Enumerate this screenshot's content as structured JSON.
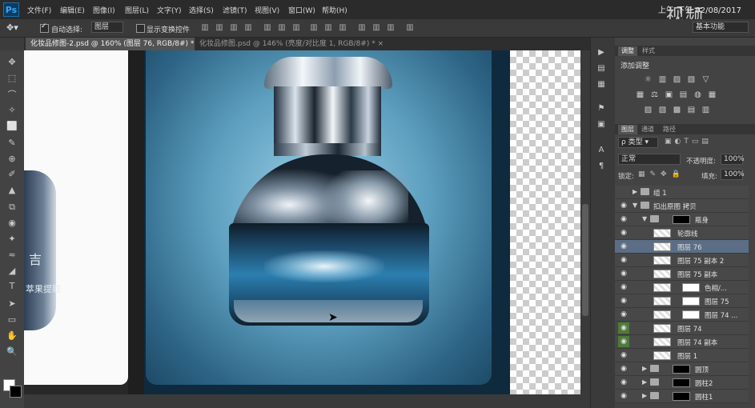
{
  "app": {
    "logo": "Ps",
    "datetime": "上午 下午 02/08/2017",
    "watermark": "视频"
  },
  "menu": [
    "文件(F)",
    "编辑(E)",
    "图像(I)",
    "图层(L)",
    "文字(Y)",
    "选择(S)",
    "滤镜(T)",
    "视图(V)",
    "窗口(W)",
    "帮助(H)"
  ],
  "options": {
    "auto_select_label": "自动选择:",
    "auto_select_value": "图层",
    "show_transform_label": "显示变换控件",
    "workspace": "基本功能"
  },
  "tabs": [
    {
      "label": "化妆品修图-2.psd @ 160% (图层 76, RGB/8#) *"
    },
    {
      "label": "化妆品修图.psd @ 146% (亮度/对比度 1, RGB/8#) *"
    }
  ],
  "canvas_text": {
    "left_text_1": "吉",
    "left_text_2": "萃果提取"
  },
  "panels": {
    "adjust_tab": "调整",
    "style_tab": "样式",
    "add_adjust": "添加调整",
    "layers_tab": "图层",
    "channels_tab": "通道",
    "paths_tab": "路径",
    "filter_kind": "类型",
    "blend_mode": "正常",
    "opacity_label": "不透明度:",
    "opacity_value": "100%",
    "lock_label": "锁定:",
    "fill_label": "填充:",
    "fill_value": "100%"
  },
  "layers": [
    {
      "name": "组 1",
      "kind": "group",
      "visible": false,
      "indent": 0,
      "expanded": false
    },
    {
      "name": "扣出原图 拷贝",
      "kind": "group",
      "visible": true,
      "indent": 0,
      "expanded": true
    },
    {
      "name": "瓶身",
      "kind": "group",
      "visible": true,
      "indent": 1,
      "expanded": true
    },
    {
      "name": "轮廓线",
      "kind": "layer",
      "visible": true,
      "indent": 2
    },
    {
      "name": "图层 76",
      "kind": "layer",
      "visible": true,
      "indent": 2,
      "selected": true
    },
    {
      "name": "图层 75 副本 2",
      "kind": "layer",
      "visible": true,
      "indent": 2
    },
    {
      "name": "图层 75 副本",
      "kind": "layer",
      "visible": true,
      "indent": 2
    },
    {
      "name": "色相/...",
      "kind": "adjust",
      "visible": true,
      "indent": 2
    },
    {
      "name": "图层 75",
      "kind": "layer",
      "visible": true,
      "indent": 2
    },
    {
      "name": "图层 74 ...",
      "kind": "layer",
      "visible": true,
      "indent": 2
    },
    {
      "name": "图层 74",
      "kind": "layer",
      "visible": true,
      "indent": 2,
      "green": true
    },
    {
      "name": "图层 74 副本",
      "kind": "layer",
      "visible": true,
      "indent": 2,
      "green": true
    },
    {
      "name": "图层 1",
      "kind": "layer",
      "visible": true,
      "indent": 2
    },
    {
      "name": "圆顶",
      "kind": "group",
      "visible": true,
      "indent": 1,
      "expanded": false
    },
    {
      "name": "圆柱2",
      "kind": "group",
      "visible": true,
      "indent": 1,
      "expanded": false
    },
    {
      "name": "圆柱1",
      "kind": "group",
      "visible": true,
      "indent": 1,
      "expanded": false
    }
  ]
}
